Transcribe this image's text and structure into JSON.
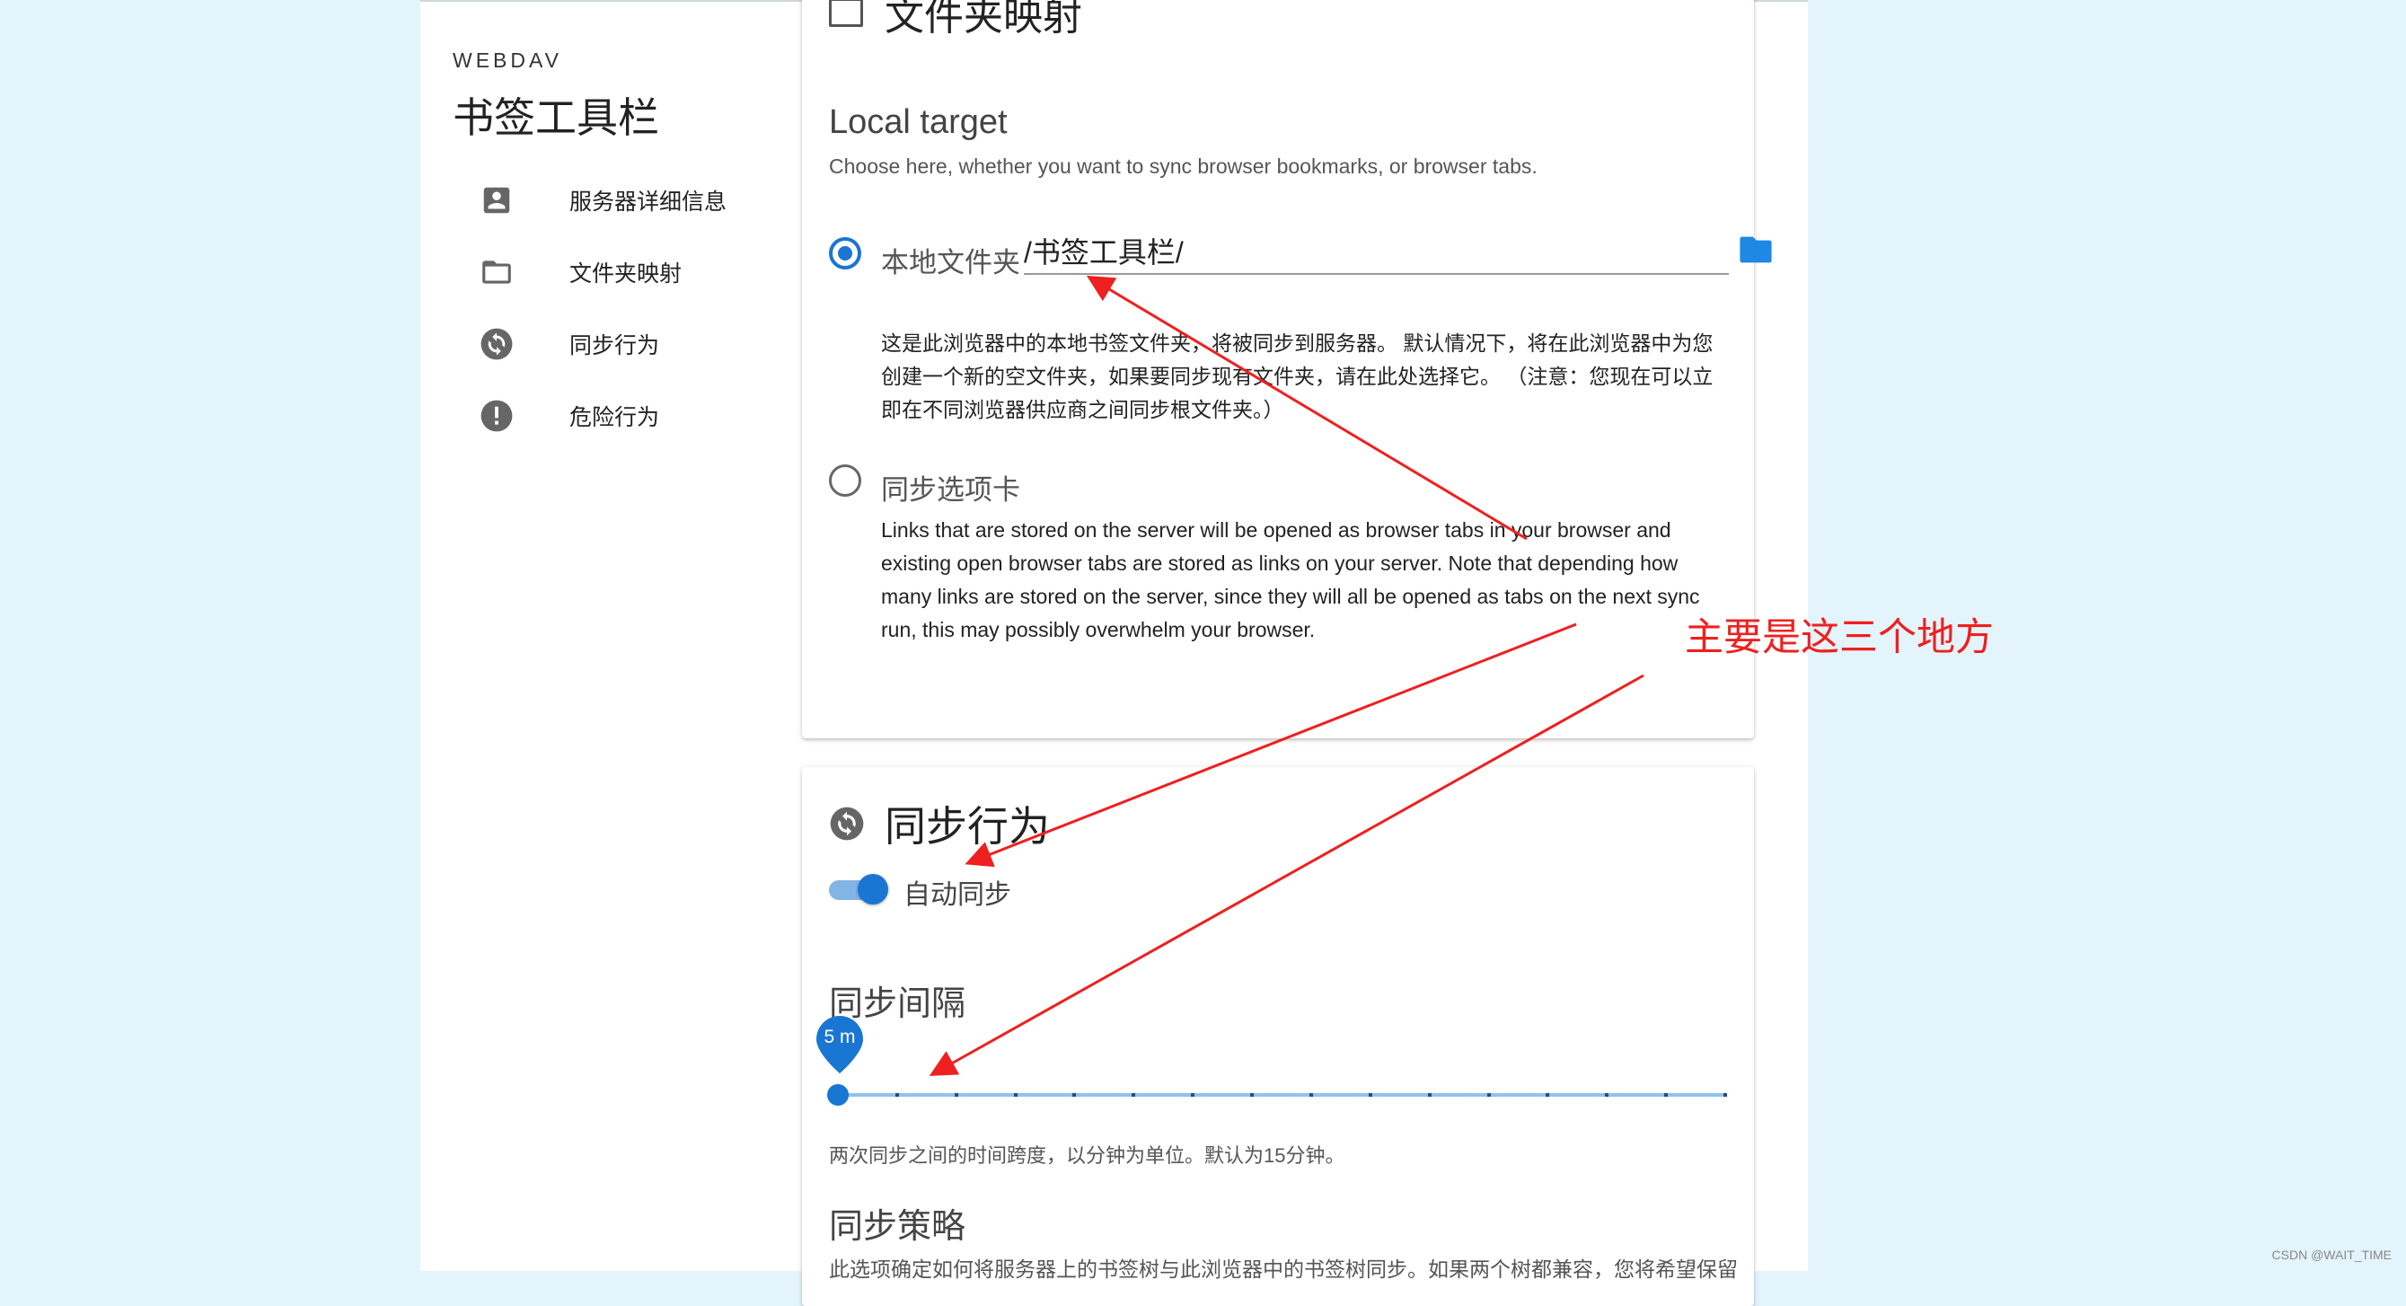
{
  "sidebar": {
    "overline": "WEBDAV",
    "title": "书签工具栏",
    "items": [
      {
        "label": "服务器详细信息",
        "icon": "account-box-icon"
      },
      {
        "label": "文件夹映射",
        "icon": "folder-outline-icon"
      },
      {
        "label": "同步行为",
        "icon": "sync-circle-icon"
      },
      {
        "label": "危险行为",
        "icon": "alert-circle-icon"
      }
    ]
  },
  "folder_card": {
    "title": "文件夹映射",
    "local_target": {
      "title": "Local target",
      "subtitle": "Choose here, whether you want to sync browser bookmarks, or browser tabs."
    },
    "option_local": {
      "label": "本地文件夹",
      "value": "/书签工具栏/",
      "selected": true,
      "description": "这是此浏览器中的本地书签文件夹，将被同步到服务器。 默认情况下，将在此浏览器中为您创建一个新的空文件夹，如果要同步现有文件夹，请在此处选择它。 （注意：您现在可以立即在不同浏览器供应商之间同步根文件夹。）"
    },
    "option_tabs": {
      "label": "同步选项卡",
      "selected": false,
      "description": "Links that are stored on the server will be opened as browser tabs in your browser and existing open browser tabs are stored as links on your server. Note that depending how many links are stored on the server, since they will all be opened as tabs on the next sync run, this may possibly overwhelm your browser."
    }
  },
  "sync_card": {
    "title": "同步行为",
    "auto_sync": {
      "label": "自动同步",
      "enabled": true
    },
    "interval": {
      "title": "同步间隔",
      "value_label": "5 m",
      "value": 5,
      "help": "两次同步之间的时间跨度，以分钟为单位。默认为15分钟。"
    },
    "strategy": {
      "title": "同步策略",
      "help_clipped": "此选项确定如何将服务器上的书签树与此浏览器中的书签树同步。如果两个树都兼容，您将希望保留"
    }
  },
  "annotation": {
    "text": "主要是这三个地方",
    "color": "#ee2020"
  },
  "watermark": "CSDN @WAIT_TIME",
  "colors": {
    "accent": "#1976d2",
    "background": "#e3f4fc"
  }
}
